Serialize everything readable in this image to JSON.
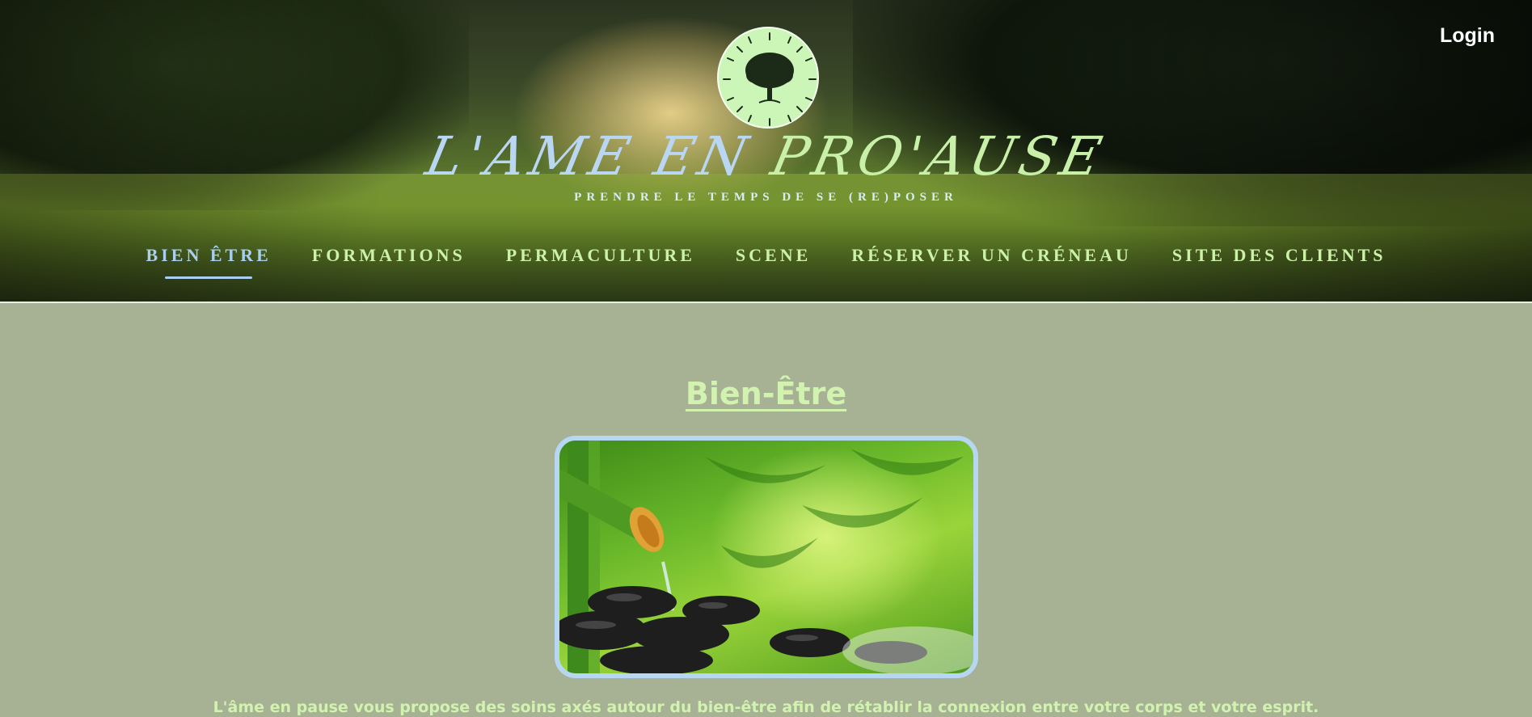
{
  "header": {
    "login_label": "Login",
    "brand_part1": "L'AME EN ",
    "brand_part2": "PRO'AUSE",
    "tagline": "PRENDRE LE TEMPS DE SE (RE)POSER",
    "logo_icon": "tree-icon"
  },
  "nav": {
    "items": [
      {
        "label": "BIEN ÊTRE",
        "active": true
      },
      {
        "label": "FORMATIONS",
        "active": false
      },
      {
        "label": "PERMACULTURE",
        "active": false
      },
      {
        "label": "SCENE",
        "active": false
      },
      {
        "label": "RÉSERVER UN CRÉNEAU",
        "active": false
      },
      {
        "label": "SITE DES CLIENTS",
        "active": false
      }
    ]
  },
  "main": {
    "title": "Bien-Être",
    "intro": "L'âme en pause vous propose des soins axés autour du bien-être afin de rétablir la connexion entre votre corps et votre esprit."
  },
  "colors": {
    "page_background": "#a7b194",
    "accent_green": "#d2f3b0",
    "accent_blue": "#a9cff0",
    "logo_fill": "#ccf5b8"
  }
}
